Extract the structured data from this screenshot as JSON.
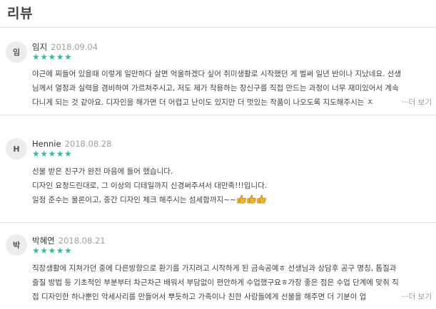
{
  "title": "리뷰",
  "colors": {
    "star": "#2bbfa5",
    "thumbs": "#f0b428"
  },
  "reviews": [
    {
      "avatar": "임",
      "author": "임지",
      "date": "2018.09.04",
      "rating": 5,
      "stars": "★★★★★",
      "lines": [
        "야근에 찌들어 있을때 이렇게 일만하다 살면 억울하겠다 싶어 취미생활로 시작했던 게 벌써 일년 반이나 지났네요. 선생",
        "님께서 열정과 실력을 겸비하여 가르쳐주시고, 저도 제가 착용하는 장신구를 직접 만드는 과정이 너무 재미있어서 계속",
        "다니게 되는 것 같아요. 디자인을 해가면 더 어렵고 난이도 있지만 더 멋있는 작품이 나오도록 지도해주시는 ㅈ"
      ],
      "more": "···더 보기"
    },
    {
      "avatar": "H",
      "author": "Hennie",
      "date": "2018.08.28",
      "rating": 5,
      "stars": "★★★★★",
      "lines": [
        "선물 받은 친구가 완전 마음에 들어 했습니다.",
        "디자인 요청드린대로, 그 이상의 디테일까지 신경써주셔서 대만족!!!입니다.",
        "일정 준수는 물론이고, 중간 디자인 체크 해주시는 섬세함까지~~"
      ],
      "thumbs_icon": "thumbs-up-icon",
      "thumbs_count": 3
    },
    {
      "avatar": "박",
      "author": "박혜연",
      "date": "2018.08.21",
      "rating": 5,
      "stars": "★★★★★",
      "lines": [
        "직장생활에 지쳐가던 중에 다른방향으로 환기를 가지려고 시작하게 된 금속공예ㅎ 선생님과 상담후 공구 명칭, 톱질과",
        "줄질 방법 등 기초적인 부분부터 차근차근 배워서 부담없이 편안하게 수업했구요ㅎ가장 좋은 점은 수업 단계에 맞춰 직",
        "접 디자인한 하나뿐인 악세사리를 만들어서 뿌듯하고 가족이나 친한 사람들에게 선물을 해주면 더 기분이 업"
      ],
      "more": "···더 보기"
    }
  ]
}
